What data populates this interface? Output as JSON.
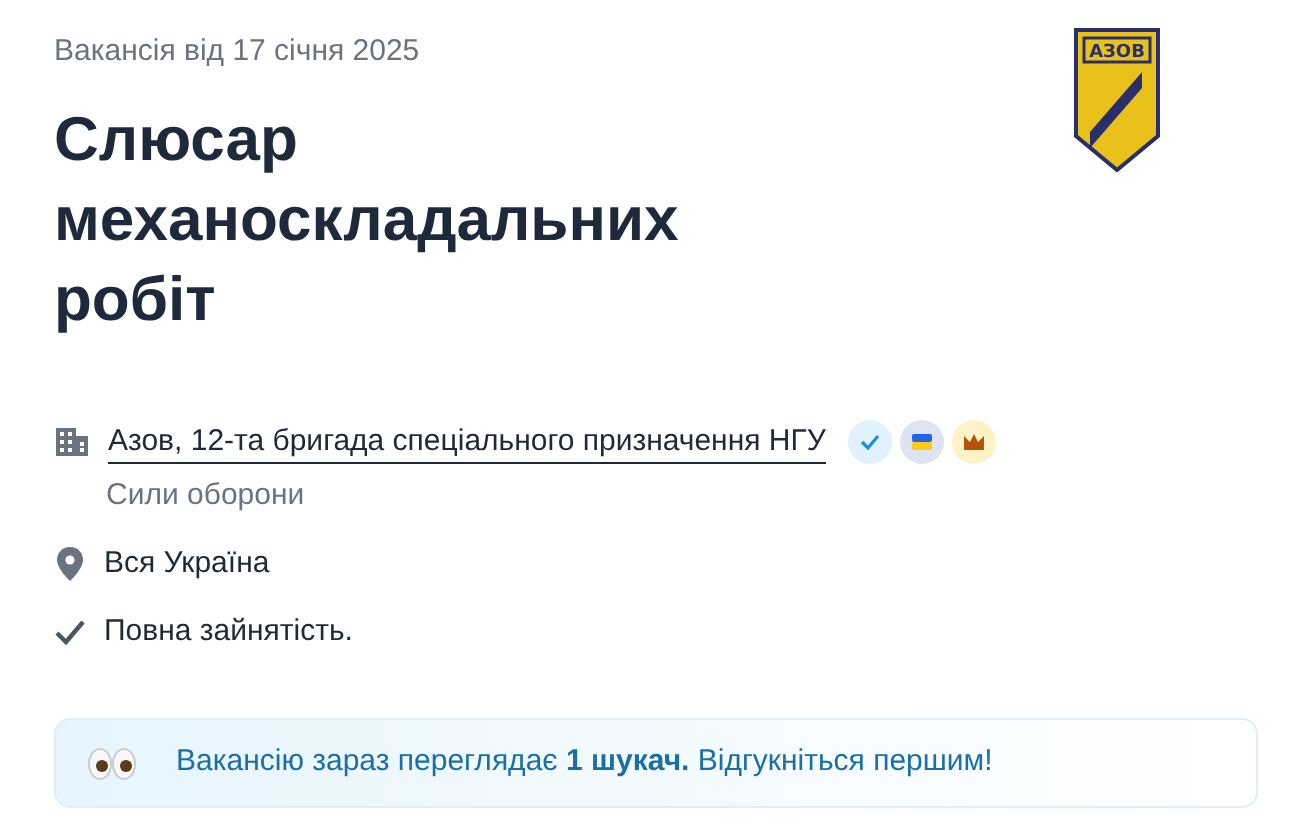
{
  "posted": "Вакансія від 17 січня 2025",
  "title": "Слюсар механоскладальних робіт",
  "logo": {
    "text": "АЗОВ"
  },
  "company": {
    "name": "Азов, 12-та бригада спеціального призначення НГУ",
    "badges": [
      {
        "kind": "verified"
      },
      {
        "kind": "flag"
      },
      {
        "kind": "crown"
      }
    ],
    "category": "Сили оборони"
  },
  "location": "Вся Україна",
  "employment": "Повна зайнятість.",
  "notice": "Вакансію зараз переглядає **1 шукач.** Відгукніться першим!"
}
